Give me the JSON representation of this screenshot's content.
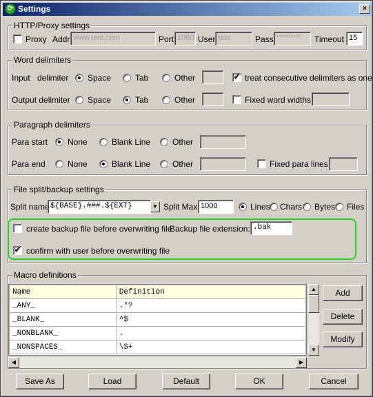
{
  "window": {
    "title": "Settings",
    "close_label": "×"
  },
  "proxy": {
    "legend": "HTTP/Proxy settings",
    "proxy_label": "Proxy",
    "addr_label": "Addr",
    "addr_placeholder": "www.test.com",
    "port_label": "Port",
    "port_placeholder": "1080",
    "user_label": "User",
    "user_placeholder": "test.",
    "pass_label": "Pass",
    "pass_placeholder": "**********",
    "timeout_label": "Timeout",
    "timeout_value": "15",
    "proxy_checked": false
  },
  "word_delimiters": {
    "legend": "Word delimiters",
    "input_label": "Input",
    "delimiter_label": "delimiter",
    "output_label": "Output delimiter",
    "space": "Space",
    "tab": "Tab",
    "other": "Other",
    "treat_consecutive": "treat consecutive delimiters as one",
    "fixed_widths": "Fixed word widths",
    "input_selected": "Space",
    "output_selected": "Tab",
    "treat_consecutive_checked": true,
    "fixed_widths_checked": false
  },
  "paragraph_delimiters": {
    "legend": "Paragraph delimiters",
    "para_start": "Para start",
    "para_end": "Para end",
    "none": "None",
    "blank_line": "Blank Line",
    "other": "Other",
    "fixed_para_lines": "Fixed para lines",
    "start_selected": "None",
    "end_selected": "Blank Line",
    "fixed_para_lines_checked": false
  },
  "file_split": {
    "legend": "File split/backup settings",
    "split_name_label": "Split name:",
    "split_name_value": "${BASE}.###.${EXT}",
    "split_max_label": "Split Max:",
    "split_max_value": "1000",
    "units": [
      "Lines",
      "Chars",
      "Bytes",
      "Files"
    ],
    "units_selected": "Lines",
    "create_backup": "create backup file before overwriting file",
    "create_backup_checked": false,
    "backup_ext_label": "Backup file extension:",
    "backup_ext_value": ".bak",
    "confirm": "confirm with user before overwriting file",
    "confirm_checked": true,
    "highlight_color": "#22d422"
  },
  "macros": {
    "legend": "Macro definitions",
    "columns": [
      "Name",
      "Definition"
    ],
    "rows": [
      {
        "name": "_ANY_",
        "definition": ".*?"
      },
      {
        "name": "_BLANK_",
        "definition": "^$"
      },
      {
        "name": "_NONBLANK_",
        "definition": "."
      },
      {
        "name": "_NONSPACES_",
        "definition": "\\S+"
      }
    ],
    "add": "Add",
    "delete": "Delete",
    "modify": "Modify"
  },
  "footer": {
    "save_as": "Save As",
    "load": "Load",
    "default": "Default",
    "ok": "OK",
    "cancel": "Cancel"
  },
  "icons": {
    "check": "✔",
    "scroll_up": "▲",
    "scroll_down": "▼",
    "scroll_left": "◀",
    "scroll_right": "▶",
    "dropdown": "▼"
  }
}
